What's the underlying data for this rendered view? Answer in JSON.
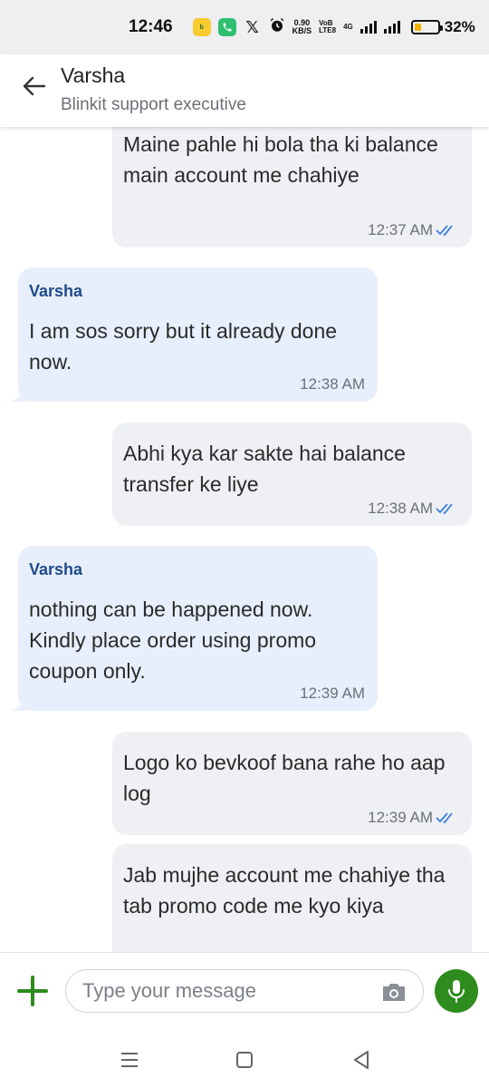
{
  "status_bar": {
    "time": "12:46",
    "net_speed_value": "0.90",
    "net_speed_unit": "KB/S",
    "volte_top": "VoB",
    "volte_bottom": "LTE8",
    "network": "4G",
    "battery_percent": "32%",
    "battery_level": 0.32,
    "icons": [
      "blinkit-app-icon",
      "phone-app-icon",
      "x-app-icon",
      "alarm-icon",
      "signal-icon",
      "battery-icon"
    ]
  },
  "header": {
    "title": "Varsha",
    "subtitle": "Blinkit support executive"
  },
  "messages": [
    {
      "direction": "out",
      "text": "Maine pahle hi bola tha ki balance main account me chahiye",
      "time": "12:37 AM",
      "read": true
    },
    {
      "direction": "in",
      "sender": "Varsha",
      "text": "I am sos sorry but it already done now.",
      "time": "12:38 AM"
    },
    {
      "direction": "out",
      "text": "Abhi kya kar sakte hai balance transfer ke liye",
      "time": "12:38 AM",
      "read": true
    },
    {
      "direction": "in",
      "sender": "Varsha",
      "text": "nothing can be happened now. Kindly place order using promo coupon only.",
      "time": "12:39 AM"
    },
    {
      "direction": "out",
      "text": "Logo ko bevkoof bana rahe ho aap log",
      "time": "12:39 AM",
      "read": true
    },
    {
      "direction": "out",
      "text": "Jab mujhe account me chahiye tha tab promo code me kyo kiya",
      "time": "",
      "read": false
    }
  ],
  "composer": {
    "placeholder": "Type your message"
  },
  "colors": {
    "accent_green": "#2e8b1d",
    "sender_blue": "#1e4a8c",
    "read_tick_blue": "#3b7de0",
    "incoming_bubble": "#e8effc",
    "outgoing_bubble": "#eef0f4"
  }
}
